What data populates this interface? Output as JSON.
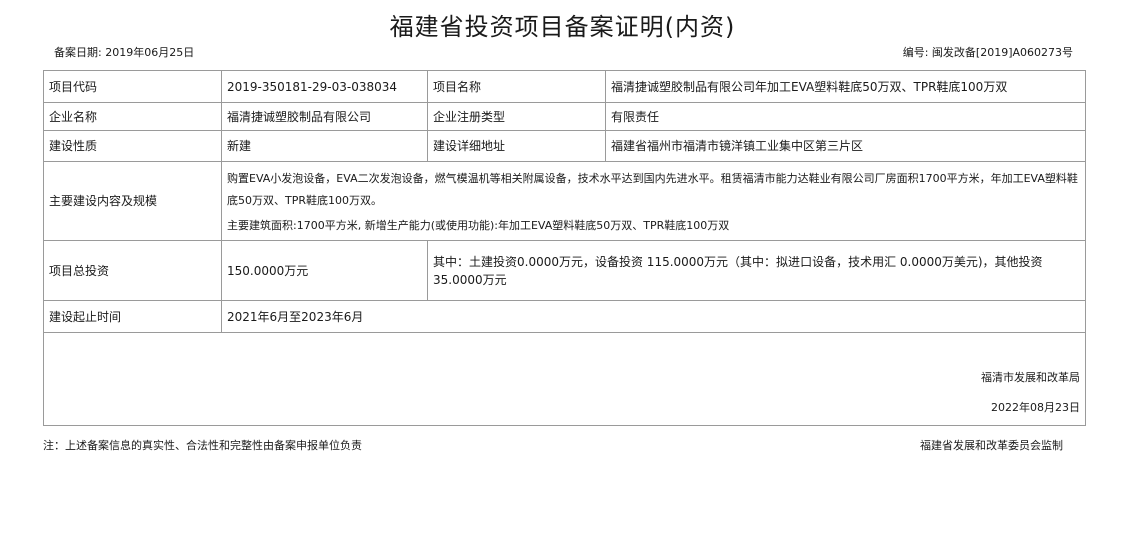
{
  "title": "福建省投资项目备案证明(内资)",
  "filing_date": "备案日期:  2019年06月25日",
  "doc_number": "编号:  闽发改备[2019]A060273号",
  "rows": {
    "project_code": {
      "label": "项目代码",
      "value": "2019-350181-29-03-038034"
    },
    "project_name": {
      "label": "项目名称",
      "value": "福清捷诚塑胶制品有限公司年加工EVA塑料鞋底50万双、TPR鞋底100万双"
    },
    "company_name": {
      "label": "企业名称",
      "value": "福清捷诚塑胶制品有限公司"
    },
    "company_type": {
      "label": "企业注册类型",
      "value": "有限责任"
    },
    "construction_nature": {
      "label": "建设性质",
      "value": "新建"
    },
    "address": {
      "label": "建设详细地址",
      "value": "福建省福州市福清市镜洋镇工业集中区第三片区"
    },
    "content": {
      "label": "主要建设内容及规模",
      "text1": "购置EVA小发泡设备，EVA二次发泡设备，燃气模温机等相关附属设备，技术水平达到国内先进水平。租赁福清市能力达鞋业有限公司厂房面积1700平方米，年加工EVA塑料鞋底50万双、TPR鞋底100万双。",
      "text2": "主要建筑面积:1700平方米, 新增生产能力(或使用功能):年加工EVA塑料鞋底50万双、TPR鞋底100万双"
    },
    "investment": {
      "label": "项目总投资",
      "total": "150.0000万元",
      "detail": "其中：土建投资0.0000万元，设备投资 115.0000万元（其中：拟进口设备，技术用汇 0.0000万美元)，其他投资35.0000万元"
    },
    "period": {
      "label": "建设起止时间",
      "value": "2021年6月至2023年6月"
    }
  },
  "signature": {
    "org": "福清市发展和改革局",
    "date": "2022年08月23日"
  },
  "footer": {
    "note": "注：上述备案信息的真实性、合法性和完整性由备案申报单位负责",
    "supervisor": "福建省发展和改革委员会监制"
  }
}
